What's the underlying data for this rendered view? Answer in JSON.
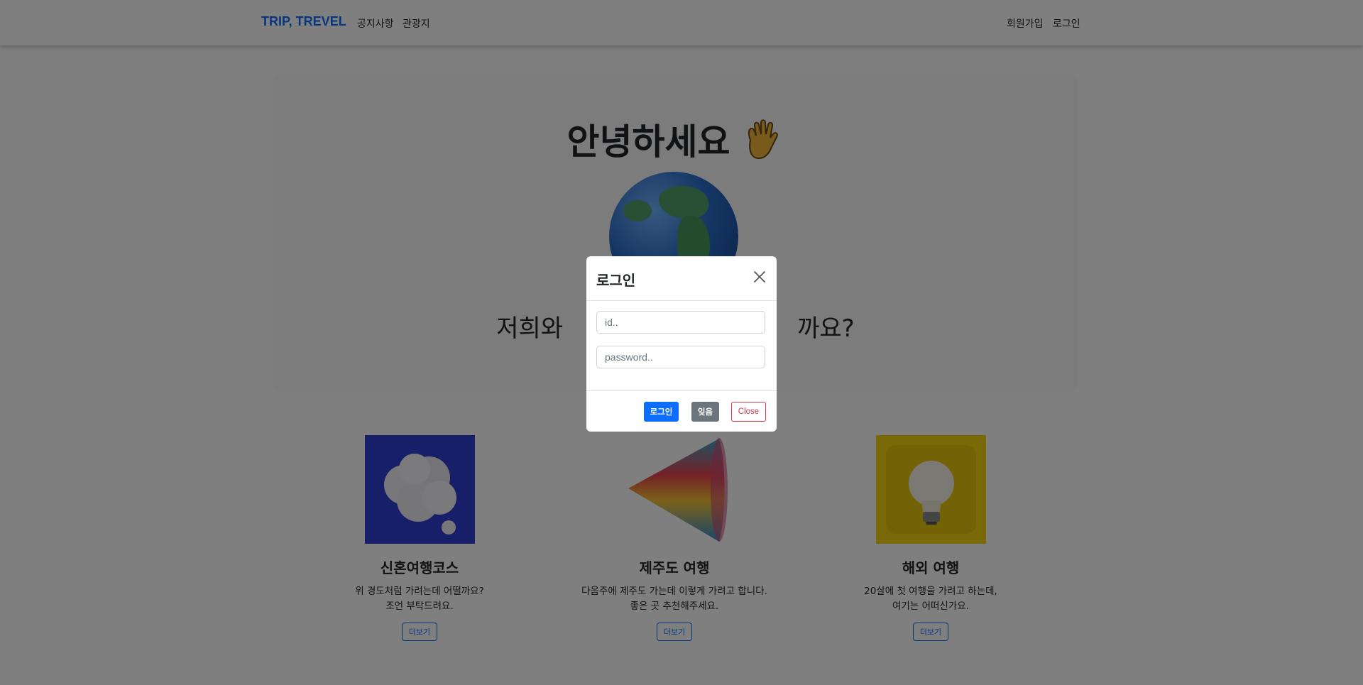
{
  "navbar": {
    "brand": "TRIP, TREVEL",
    "links": [
      "공지사항",
      "관광지"
    ],
    "right_links": [
      "회원가입",
      "로그인"
    ]
  },
  "hero": {
    "title": "안녕하세요",
    "hand_icon": "waving-hand",
    "globe_icon": "globe-earth",
    "subtitle_left": "저희와",
    "subtitle_right": "까요?"
  },
  "cards": [
    {
      "image": "thought-cloud-icon",
      "title": "신혼여행코스",
      "text": [
        "위 경도처럼 가려는데 어떨까요?",
        "조언 부탁드려요."
      ],
      "button": "더보기"
    },
    {
      "image": "cone-icon",
      "title": "제주도 여행",
      "text": [
        "다음주에 제주도 가는데 이렇게 가려고 합니다.",
        "좋은 곳 추천해주세요."
      ],
      "button": "더보기"
    },
    {
      "image": "lightbulb-icon",
      "title": "해외 여행",
      "text": [
        "20살에 첫 여행을 가려고 하는데,",
        "여기는 어떠신가요."
      ],
      "button": "더보기"
    }
  ],
  "modal": {
    "title": "로그인",
    "id_placeholder": "id..",
    "password_placeholder": "password..",
    "login_button": "로그인",
    "find_button": "잊음",
    "close_button": "Close"
  },
  "colors": {
    "brand": "#0d6efd",
    "primary": "#0d6efd",
    "secondary": "#6c757d",
    "danger": "#dc3545",
    "backdrop": "rgba(0,0,0,0.5)"
  }
}
